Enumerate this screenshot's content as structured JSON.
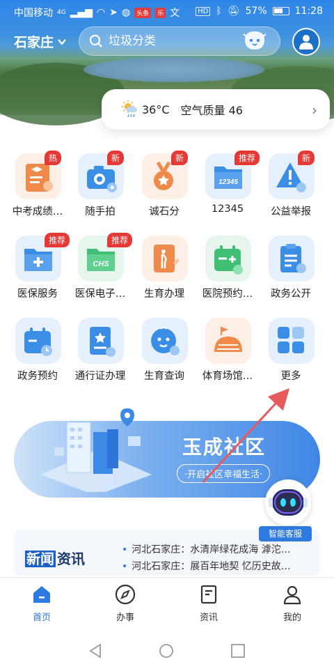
{
  "status_bar": {
    "carrier": "中国移动",
    "network": "4G",
    "app_badge_1": "头条",
    "app_badge_2": "乐",
    "battery": "57%",
    "time": "11:28",
    "hd": "HD"
  },
  "header": {
    "city": "石家庄",
    "search_placeholder": "垃圾分类"
  },
  "weather": {
    "temp": "36°C",
    "air_quality": "空气质量 46"
  },
  "grid_rows": [
    [
      {
        "label": "中考成绩…",
        "badge": "热",
        "icon": "certificate-icon",
        "bg": "#fdeee6"
      },
      {
        "label": "随手拍",
        "badge": "新",
        "icon": "camera-icon",
        "bg": "#e6f0fc"
      },
      {
        "label": "诚石分",
        "badge": "新",
        "icon": "medal-icon",
        "bg": "#fdeee6"
      },
      {
        "label": "12345",
        "badge": "推荐",
        "icon": "hotline-folder-icon",
        "bg": "#e6f0fc"
      },
      {
        "label": "公益举报",
        "badge": "新",
        "icon": "alert-triangle-icon",
        "bg": "#e6f0fc"
      }
    ],
    [
      {
        "label": "医保服务",
        "badge": "推荐",
        "icon": "medical-folder-icon",
        "bg": "#e6f0fc"
      },
      {
        "label": "医保电子…",
        "badge": "推荐",
        "icon": "chs-card-icon",
        "bg": "#e7f6ec"
      },
      {
        "label": "生育办理",
        "badge": "",
        "icon": "pregnancy-doc-icon",
        "bg": "#fdeee6"
      },
      {
        "label": "医院预约…",
        "badge": "",
        "icon": "hospital-calendar-icon",
        "bg": "#e7f6ec"
      },
      {
        "label": "政务公开",
        "badge": "",
        "icon": "clipboard-icon",
        "bg": "#e6f0fc"
      }
    ],
    [
      {
        "label": "政务预约",
        "badge": "",
        "icon": "calendar-clock-icon",
        "bg": "#e6f0fc"
      },
      {
        "label": "通行证办理",
        "badge": "",
        "icon": "pass-card-icon",
        "bg": "#e6f0fc"
      },
      {
        "label": "生育查询",
        "badge": "",
        "icon": "baby-face-icon",
        "bg": "#e6f0fc"
      },
      {
        "label": "体育场馆…",
        "badge": "",
        "icon": "stadium-icon",
        "bg": "#fdeee6"
      },
      {
        "label": "更多",
        "badge": "",
        "icon": "more-grid-icon",
        "bg": "#e6f0fc"
      }
    ]
  ],
  "banner": {
    "title": "玉成社区",
    "subtitle": "·开启社区幸福生活·"
  },
  "assistant": {
    "label": "智能客服"
  },
  "news": {
    "brand_1": "新闻",
    "brand_2": "资讯",
    "items": [
      "河北石家庄：水清岸绿花成海 滹沱…",
      "河北石家庄：展百年地契 忆历史故…"
    ]
  },
  "tabs": [
    {
      "label": "首页",
      "active": true
    },
    {
      "label": "办事"
    },
    {
      "label": "资讯"
    },
    {
      "label": "我的"
    }
  ],
  "colors": {
    "accent": "#2d7ae0",
    "badge_red": "#e53935"
  }
}
